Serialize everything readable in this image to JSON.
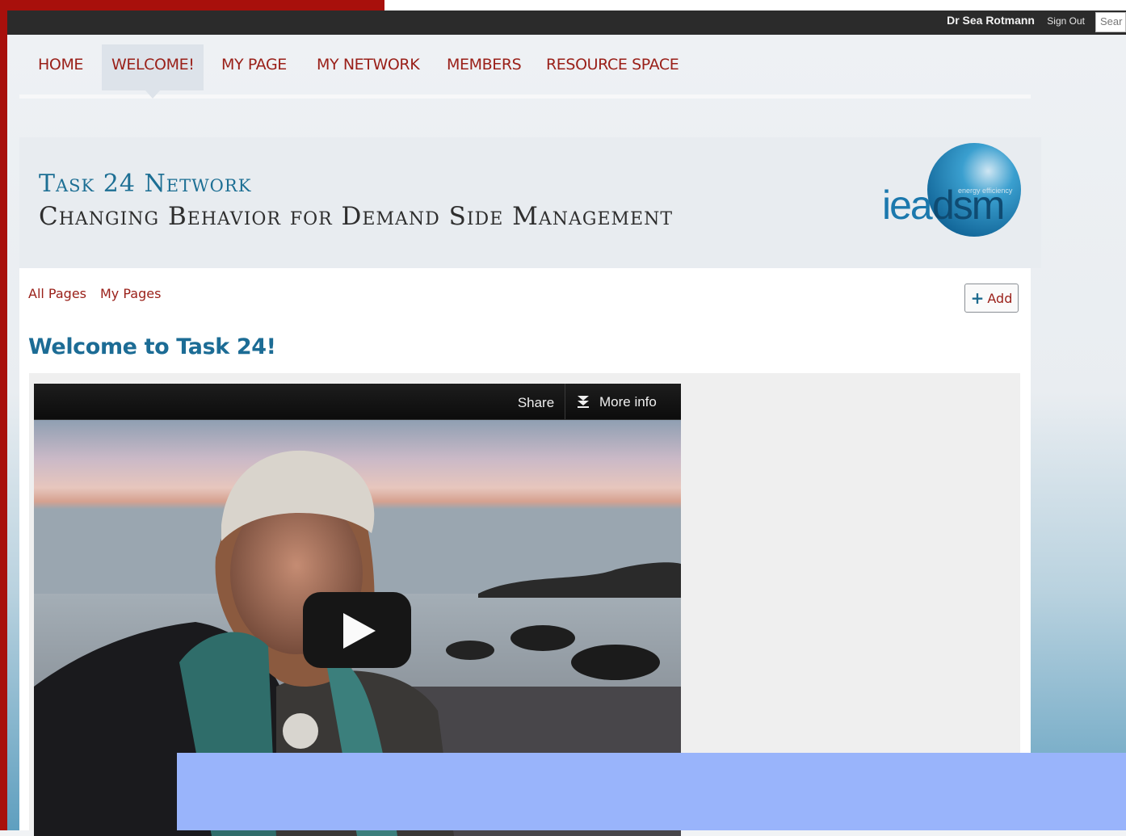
{
  "topbar": {
    "user_name": "Dr Sea Rotmann",
    "sign_out": "Sign Out",
    "search_placeholder": "Sear"
  },
  "nav": {
    "items": [
      {
        "label": "HOME",
        "active": false
      },
      {
        "label": "WELCOME!",
        "active": true
      },
      {
        "label": "MY PAGE",
        "active": false
      },
      {
        "label": "MY NETWORK",
        "active": false
      },
      {
        "label": "MEMBERS",
        "active": false
      },
      {
        "label": "RESOURCE SPACE",
        "active": false
      }
    ]
  },
  "header": {
    "title": "Task 24 Network",
    "subtitle": "Changing Behavior for Demand Side Management",
    "logo_text": "ieadsm",
    "logo_tagline": "energy efficiency"
  },
  "subnav": {
    "all_pages": "All Pages",
    "my_pages": "My Pages",
    "add_label": "Add"
  },
  "page": {
    "title": "Welcome to Task 24!"
  },
  "video": {
    "share_label": "Share",
    "more_info_label": "More info"
  },
  "colors": {
    "brand_red": "#9a2019",
    "frame_red": "#a8100c",
    "title_blue": "#1c6c95",
    "overlay_blue": "#99b4fb"
  }
}
